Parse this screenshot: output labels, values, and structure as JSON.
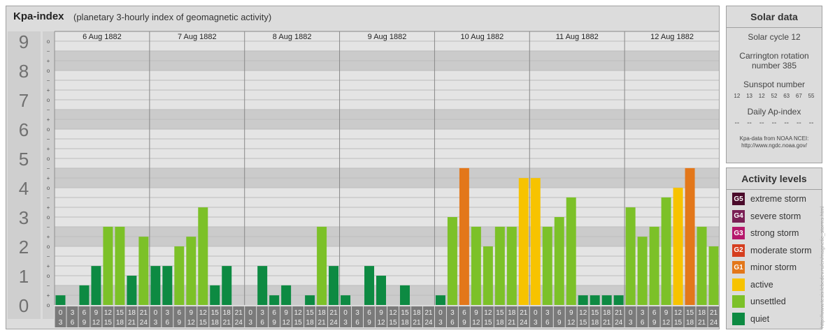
{
  "header": {
    "title": "Kpa-index",
    "subtitle": "(planetary 3-hourly index of geomagnetic activity)"
  },
  "chart_data": {
    "type": "bar",
    "ylim": [
      0,
      9
    ],
    "y_ticks": [
      "9",
      "8",
      "7",
      "6",
      "5",
      "4",
      "3",
      "2",
      "1",
      "0"
    ],
    "sub_ticks": [
      "o",
      "−",
      "+"
    ],
    "days": [
      "6 Aug 1882",
      "7 Aug 1882",
      "8 Aug 1882",
      "9 Aug 1882",
      "10 Aug 1882",
      "11 Aug 1882",
      "12 Aug 1882"
    ],
    "intervals": [
      {
        "start": "0",
        "end": "3"
      },
      {
        "start": "3",
        "end": "6"
      },
      {
        "start": "6",
        "end": "9"
      },
      {
        "start": "9",
        "end": "12"
      },
      {
        "start": "12",
        "end": "15"
      },
      {
        "start": "15",
        "end": "18"
      },
      {
        "start": "18",
        "end": "21"
      },
      {
        "start": "21",
        "end": "24"
      }
    ],
    "series": [
      {
        "values": [
          0.33,
          0,
          0.67,
          1.33,
          2.67,
          2.67,
          1,
          2.33
        ]
      },
      {
        "values": [
          1.33,
          1.33,
          2,
          2.33,
          3.33,
          0.67,
          1.33,
          0
        ]
      },
      {
        "values": [
          0,
          1.33,
          0.33,
          0.67,
          0,
          0.33,
          2.67,
          1.33
        ]
      },
      {
        "values": [
          0.33,
          0,
          1.33,
          1,
          0,
          0.67,
          0,
          0
        ]
      },
      {
        "values": [
          0.33,
          3,
          4.67,
          2.67,
          2,
          2.67,
          2.67,
          4.33
        ]
      },
      {
        "values": [
          4.33,
          2.67,
          3,
          3.67,
          0.33,
          0.33,
          0.33,
          0.33
        ]
      },
      {
        "values": [
          3.33,
          2.33,
          2.67,
          3.67,
          4,
          4.67,
          2.67,
          2
        ]
      }
    ]
  },
  "solar": {
    "title": "Solar data",
    "cycle": "Solar cycle 12",
    "carrington_line1": "Carrington rotation",
    "carrington_line2": "number 385",
    "sunspot_title": "Sunspot number",
    "sunspot_values": [
      "12",
      "13",
      "12",
      "52",
      "63",
      "67",
      "55"
    ],
    "ap_title": "Daily Ap-index",
    "ap_values": [
      "--",
      "--",
      "--",
      "--",
      "--",
      "--",
      "--"
    ],
    "source_line1": "Kpa-data from NOAA NCEI:",
    "source_line2": "http://www.ngdc.noaa.gov/"
  },
  "activity": {
    "title": "Activity levels",
    "levels": [
      {
        "code": "G5",
        "label": "extreme storm",
        "color": "#4a0a2a"
      },
      {
        "code": "G4",
        "label": "severe storm",
        "color": "#7a1f55"
      },
      {
        "code": "G3",
        "label": "strong storm",
        "color": "#b5176b"
      },
      {
        "code": "G2",
        "label": "moderate storm",
        "color": "#d53e1f"
      },
      {
        "code": "G1",
        "label": "minor storm",
        "color": "#e3771a"
      },
      {
        "code": "",
        "label": "active",
        "color": "#f7c300"
      },
      {
        "code": "",
        "label": "unsettled",
        "color": "#7cc128"
      },
      {
        "code": "",
        "label": "quiet",
        "color": "#0d8a42"
      }
    ]
  },
  "colors": {
    "quiet": "#0d8a42",
    "unsettled": "#7cc128",
    "active": "#f7c300",
    "minor_storm": "#e3771a"
  },
  "watermark": "http://www.tesis.lebedev.ru/en/magnetic_storms.html"
}
